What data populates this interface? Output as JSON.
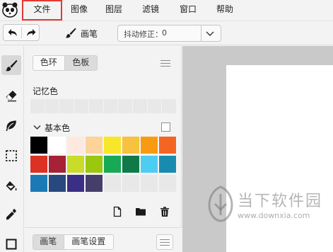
{
  "menu": {
    "items": [
      {
        "label": "文件",
        "active": true
      },
      {
        "label": "图像"
      },
      {
        "label": "图层"
      },
      {
        "label": "滤镜"
      },
      {
        "label": "窗口"
      },
      {
        "label": "帮助"
      }
    ]
  },
  "toolbar": {
    "tool_label": "画笔",
    "smooth_label": "抖动修正：",
    "smooth_value": "0"
  },
  "tools": [
    {
      "name": "brush-tool",
      "icon": "brush-icon",
      "active": true
    },
    {
      "name": "eraser-tool",
      "icon": "eraser-icon"
    },
    {
      "name": "leaf-brush-tool",
      "icon": "leaf-icon"
    },
    {
      "name": "selection-tool",
      "icon": "dashed-select-icon"
    },
    {
      "name": "fill-tool",
      "icon": "paint-bucket-icon"
    },
    {
      "name": "eyedropper-tool",
      "icon": "eyedropper-icon"
    },
    {
      "name": "shape-tool",
      "icon": "square-icon"
    }
  ],
  "panel": {
    "tabs": [
      {
        "label": "色环"
      },
      {
        "label": "色板",
        "active": true
      }
    ],
    "memory_label": "记忆色",
    "basic_label": "基本色",
    "swatches": [
      "#000000",
      "#ffffff",
      "#fde9e0",
      "#fdd39a",
      "#f7e72a",
      "#f8c13e",
      "#f99b12",
      "#f46524",
      "#dc3125",
      "#a72236",
      "#c9dc27",
      "#9bc70f",
      "#17a955",
      "#0f7a48",
      "#4dcdf2",
      "#1a8bb0",
      "#1b7ab3",
      "#27497d",
      "#3b2e85",
      "#463e6a",
      "#e8e8e8",
      "#e8e8e8",
      "#e8e8e8",
      "#e8e8e8"
    ],
    "bottom_tabs": [
      {
        "label": "画笔",
        "active": true
      },
      {
        "label": "画笔设置"
      }
    ]
  },
  "watermark": {
    "title": "当下软件园",
    "url": "www.downxia.com"
  }
}
